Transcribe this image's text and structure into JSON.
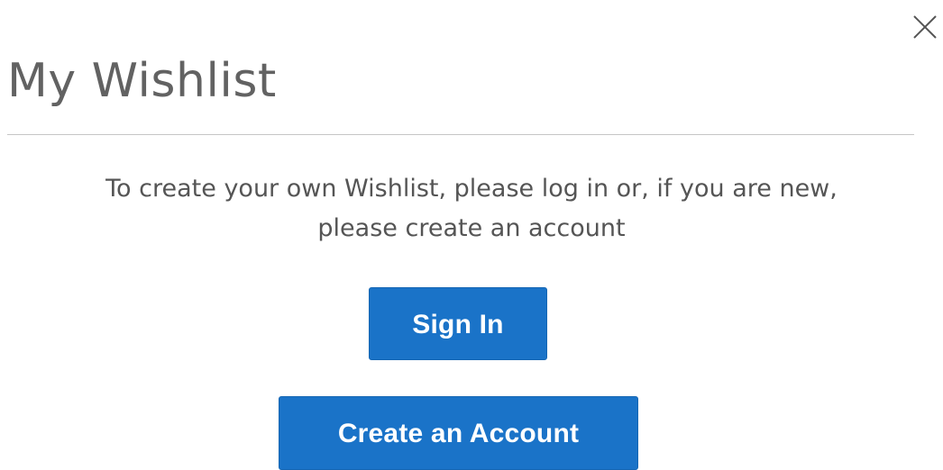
{
  "modal": {
    "title": "My Wishlist",
    "message": "To create your own Wishlist, please log in or, if you are new, please create an account",
    "close_icon": "close-icon",
    "buttons": {
      "sign_in": "Sign In",
      "create_account": "Create an Account"
    }
  },
  "colors": {
    "button_bg": "#1a73c8",
    "button_text": "#ffffff",
    "text": "#555555",
    "divider": "#c6c6c6"
  }
}
